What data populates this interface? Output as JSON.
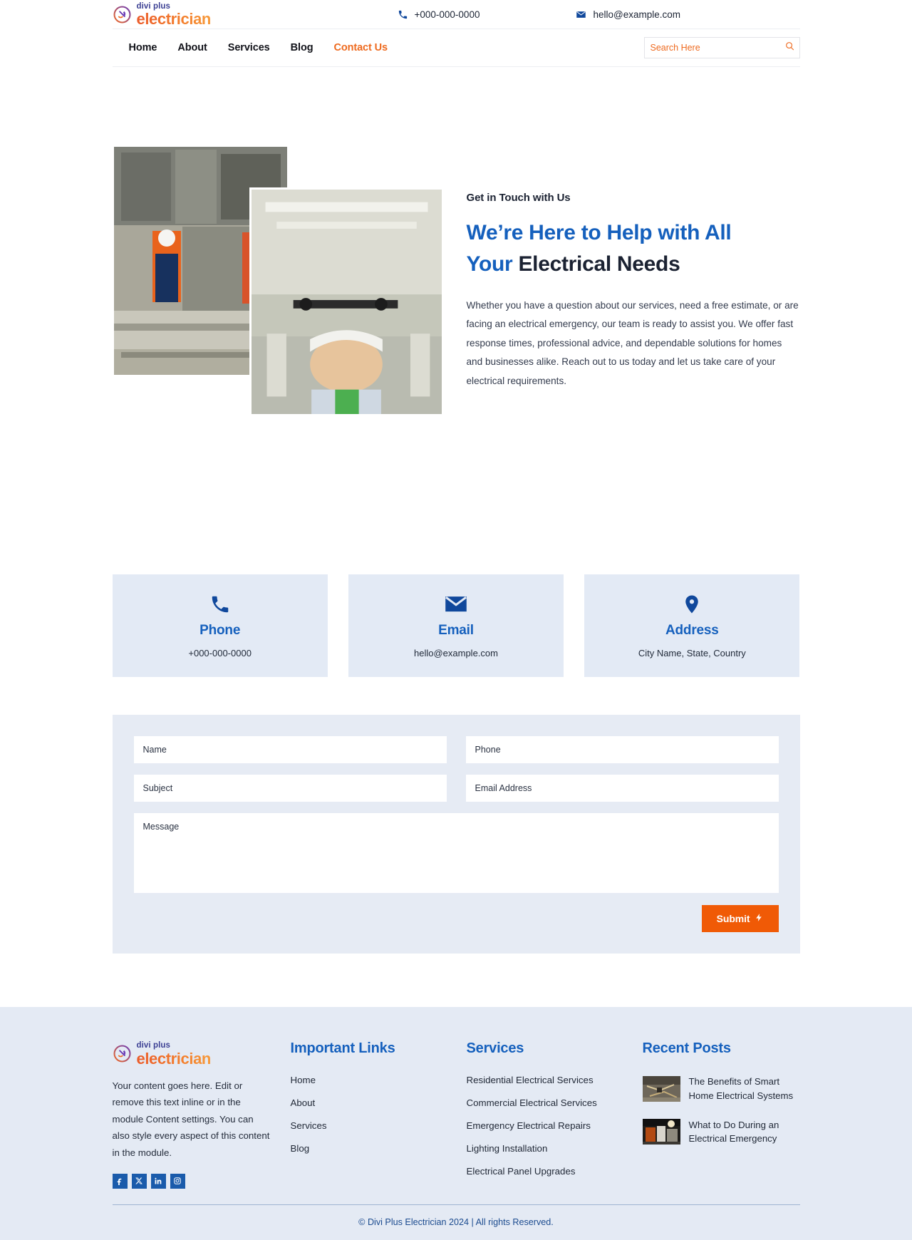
{
  "brand": {
    "top": "divi plus",
    "bottom": "electrician",
    "icon": "plug-circle-icon"
  },
  "header": {
    "phone": {
      "icon": "phone-icon",
      "value": "+000-000-0000"
    },
    "email": {
      "icon": "envelope-icon",
      "value": "hello@example.com"
    },
    "nav": [
      {
        "label": "Home",
        "active": false
      },
      {
        "label": "About",
        "active": false
      },
      {
        "label": "Services",
        "active": false
      },
      {
        "label": "Blog",
        "active": false
      },
      {
        "label": "Contact Us",
        "active": true
      }
    ],
    "search": {
      "placeholder": "Search Here",
      "value": "",
      "icon": "search-icon"
    }
  },
  "hero": {
    "eyebrow": "Get in Touch with Us",
    "title_line1_hl": "We’re Here to Help with All",
    "title_line2_hl": "Your",
    "title_line2_rest": " Electrical Needs",
    "body": "Whether you have a question about our services, need a free estimate, or are facing an electrical emergency, our team is ready to assist you. We offer fast response times, professional advice, and dependable solutions for homes and businesses alike. Reach out to us today and let us take care of your electrical requirements.",
    "image_a_alt": "electrician-working-on-panel",
    "image_b_alt": "electrician-installing-ceiling-wiring"
  },
  "cards": [
    {
      "icon": "phone-icon",
      "title": "Phone",
      "value": "+000-000-0000"
    },
    {
      "icon": "envelope-icon",
      "title": "Email",
      "value": "hello@example.com"
    },
    {
      "icon": "map-pin-icon",
      "title": "Address",
      "value": "City Name, State, Country"
    }
  ],
  "form": {
    "name": {
      "placeholder": "Name",
      "value": ""
    },
    "phone": {
      "placeholder": "Phone",
      "value": ""
    },
    "subject": {
      "placeholder": "Subject",
      "value": ""
    },
    "email": {
      "placeholder": "Email Address",
      "value": ""
    },
    "message": {
      "placeholder": "Message",
      "value": ""
    },
    "submit_label": "Submit",
    "submit_icon": "lightning-bolt-icon",
    "accent": "#f05a06"
  },
  "footer": {
    "description": "Your content goes here. Edit or remove this text inline or in the module Content settings. You can also style every aspect of this content in the module.",
    "socials": [
      {
        "name": "facebook-icon",
        "glyph": "f"
      },
      {
        "name": "x-twitter-icon",
        "glyph": "✕"
      },
      {
        "name": "linkedin-icon",
        "glyph": "in"
      },
      {
        "name": "instagram-icon",
        "glyph": "▣"
      }
    ],
    "links_title": "Important Links",
    "links": [
      {
        "label": "Home"
      },
      {
        "label": "About"
      },
      {
        "label": "Services"
      },
      {
        "label": "Blog"
      }
    ],
    "services_title": "Services",
    "services": [
      {
        "label": "Residential Electrical Services"
      },
      {
        "label": "Commercial Electrical Services"
      },
      {
        "label": "Emergency Electrical Repairs"
      },
      {
        "label": "Lighting Installation"
      },
      {
        "label": "Electrical Panel Upgrades"
      }
    ],
    "posts_title": "Recent Posts",
    "posts": [
      {
        "title": "The Benefits of Smart Home Electrical Systems",
        "thumb_alt": "wiring-junction-thumbnail"
      },
      {
        "title": "What to Do During an Electrical Emergency",
        "thumb_alt": "electrical-panel-thumbnail"
      }
    ],
    "copyright": "© Divi Plus Electrician 2024 | All rights Reserved."
  },
  "colors": {
    "brand_blue": "#1560bd",
    "brand_orange": "#ee6a1f",
    "deep_blue": "#10489c",
    "card_bg": "#e3eaf5",
    "footer_bg": "#e4eaf4"
  }
}
